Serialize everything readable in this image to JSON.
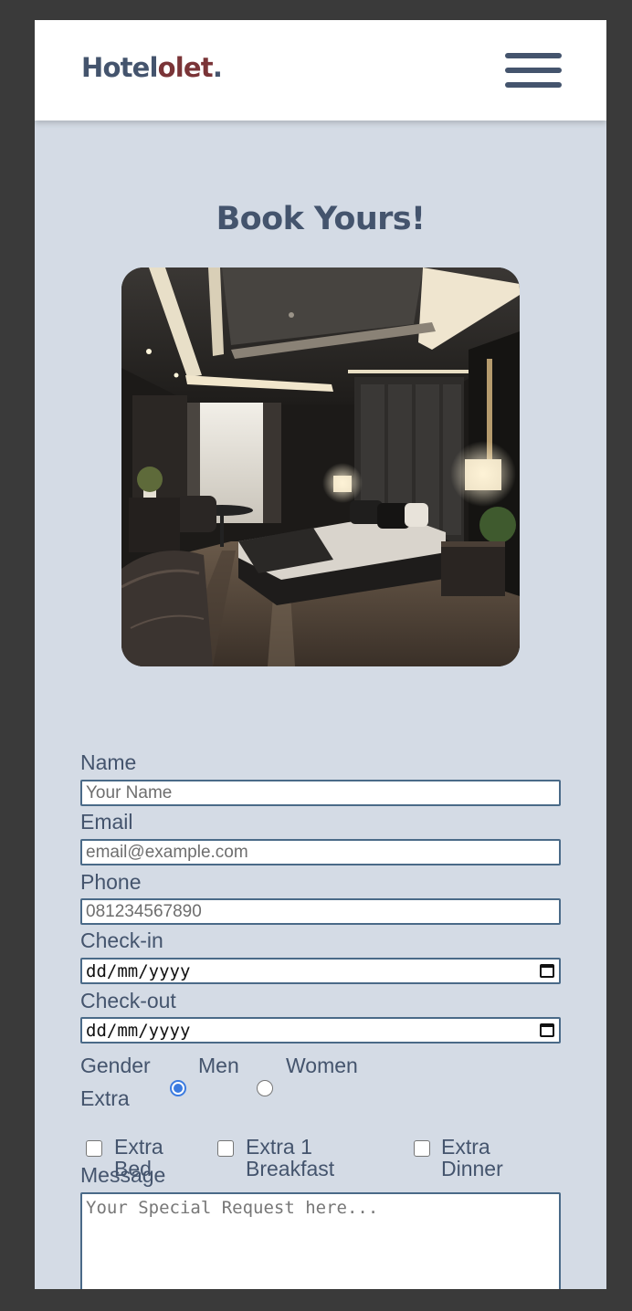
{
  "nav": {
    "logo_part1": "Hotel",
    "logo_part2": "olet",
    "logo_part3": "."
  },
  "booking": {
    "heading": "Book Yours!"
  },
  "form": {
    "name": {
      "label": "Name",
      "placeholder": "Your Name"
    },
    "email": {
      "label": "Email",
      "placeholder": "email@example.com"
    },
    "phone": {
      "label": "Phone",
      "placeholder": "081234567890"
    },
    "checkin": {
      "label": "Check-in",
      "value": "dd/mm/yyyy"
    },
    "checkout": {
      "label": "Check-out",
      "value": "dd/mm/yyyy"
    },
    "gender": {
      "label": "Gender",
      "options": [
        {
          "label": "Men",
          "checked": true
        },
        {
          "label": "Women",
          "checked": false
        }
      ]
    },
    "extra": {
      "label": "Extra",
      "options": [
        {
          "line1": "Extra",
          "line2": "Bed",
          "checked": false
        },
        {
          "line1": "Extra 1",
          "line2": "Breakfast",
          "checked": false
        },
        {
          "line1": "Extra",
          "line2": "Dinner",
          "checked": false
        }
      ]
    },
    "message": {
      "label": "Message",
      "placeholder": "Your Special Request here..."
    }
  },
  "colors": {
    "page_bg": "#d4dbe5",
    "primary_text": "#44546d",
    "logo_accent": "#7a3437",
    "radio_checked": "#3b7be0"
  },
  "icons": {
    "menu": "hamburger-menu-icon",
    "calendar": "calendar-icon"
  }
}
